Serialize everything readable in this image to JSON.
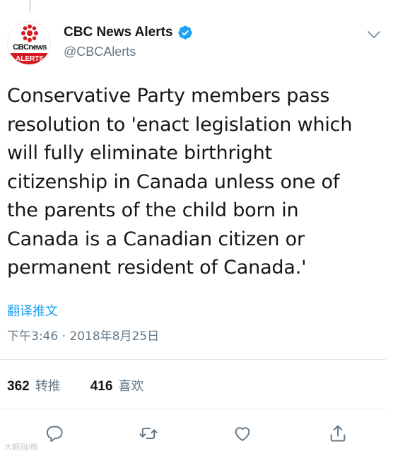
{
  "account": {
    "display_name": "CBC News Alerts",
    "handle": "@CBCAlerts",
    "avatar_text": "CBCnews",
    "avatar_badge": "ALERTS",
    "verified": true
  },
  "tweet": {
    "text_lines": [
      "Conservative Party members pass",
      "resolution to 'enact legislation which",
      "will fully eliminate birthright",
      "citizenship in Canada unless one of",
      "the parents of the child born in",
      "Canada is a Canadian citizen or",
      "permanent resident of Canada.'"
    ],
    "translate_label": "翻译推文",
    "timestamp": "下午3:46 · 2018年8月25日"
  },
  "stats": {
    "retweets_count": "362",
    "retweets_label": "转推",
    "likes_count": "416",
    "likes_label": "喜欢"
  },
  "actions": {
    "icons": [
      "reply-icon",
      "retweet-icon",
      "like-icon",
      "share-icon"
    ]
  },
  "watermark": "大眼网/微",
  "colors": {
    "accent": "#1da1f2",
    "text": "#14171a",
    "muted": "#657786",
    "border": "#e1e8ed",
    "cbc_red": "#d71920"
  }
}
